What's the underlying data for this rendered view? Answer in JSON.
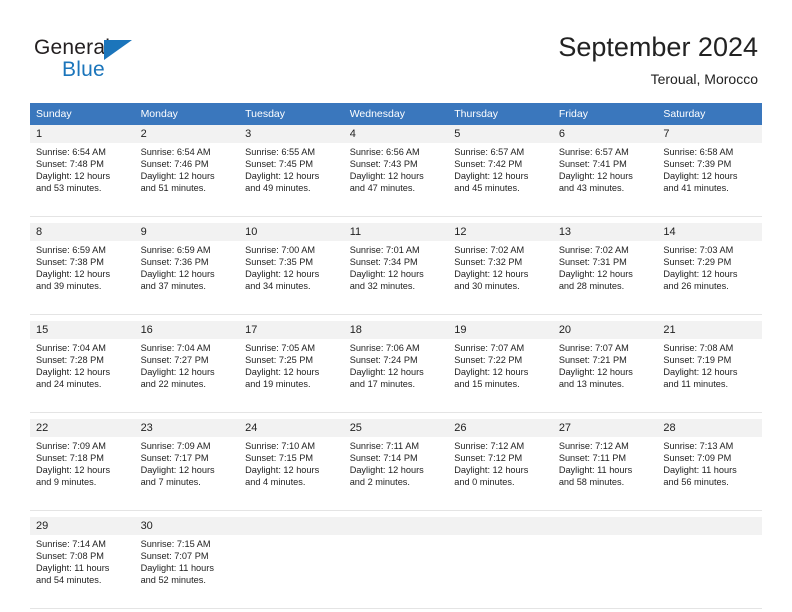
{
  "brand": {
    "name_part1": "General",
    "name_part2": "Blue",
    "triangle_color": "#1b75bb",
    "text_color": "#231f20"
  },
  "header": {
    "title": "September 2024",
    "subtitle": "Teroual, Morocco"
  },
  "theme": {
    "header_row_bg": "#3a77bd",
    "header_row_text": "#ffffff",
    "day_number_bg": "#f2f2f2",
    "cell_bg": "#ffffff",
    "text": "#222222",
    "grid_line": "#e4e4e4"
  },
  "weekdays": [
    "Sunday",
    "Monday",
    "Tuesday",
    "Wednesday",
    "Thursday",
    "Friday",
    "Saturday"
  ],
  "weeks": [
    [
      {
        "day": "1",
        "sunrise": "Sunrise: 6:54 AM",
        "sunset": "Sunset: 7:48 PM",
        "daylight1": "Daylight: 12 hours",
        "daylight2": "and 53 minutes."
      },
      {
        "day": "2",
        "sunrise": "Sunrise: 6:54 AM",
        "sunset": "Sunset: 7:46 PM",
        "daylight1": "Daylight: 12 hours",
        "daylight2": "and 51 minutes."
      },
      {
        "day": "3",
        "sunrise": "Sunrise: 6:55 AM",
        "sunset": "Sunset: 7:45 PM",
        "daylight1": "Daylight: 12 hours",
        "daylight2": "and 49 minutes."
      },
      {
        "day": "4",
        "sunrise": "Sunrise: 6:56 AM",
        "sunset": "Sunset: 7:43 PM",
        "daylight1": "Daylight: 12 hours",
        "daylight2": "and 47 minutes."
      },
      {
        "day": "5",
        "sunrise": "Sunrise: 6:57 AM",
        "sunset": "Sunset: 7:42 PM",
        "daylight1": "Daylight: 12 hours",
        "daylight2": "and 45 minutes."
      },
      {
        "day": "6",
        "sunrise": "Sunrise: 6:57 AM",
        "sunset": "Sunset: 7:41 PM",
        "daylight1": "Daylight: 12 hours",
        "daylight2": "and 43 minutes."
      },
      {
        "day": "7",
        "sunrise": "Sunrise: 6:58 AM",
        "sunset": "Sunset: 7:39 PM",
        "daylight1": "Daylight: 12 hours",
        "daylight2": "and 41 minutes."
      }
    ],
    [
      {
        "day": "8",
        "sunrise": "Sunrise: 6:59 AM",
        "sunset": "Sunset: 7:38 PM",
        "daylight1": "Daylight: 12 hours",
        "daylight2": "and 39 minutes."
      },
      {
        "day": "9",
        "sunrise": "Sunrise: 6:59 AM",
        "sunset": "Sunset: 7:36 PM",
        "daylight1": "Daylight: 12 hours",
        "daylight2": "and 37 minutes."
      },
      {
        "day": "10",
        "sunrise": "Sunrise: 7:00 AM",
        "sunset": "Sunset: 7:35 PM",
        "daylight1": "Daylight: 12 hours",
        "daylight2": "and 34 minutes."
      },
      {
        "day": "11",
        "sunrise": "Sunrise: 7:01 AM",
        "sunset": "Sunset: 7:34 PM",
        "daylight1": "Daylight: 12 hours",
        "daylight2": "and 32 minutes."
      },
      {
        "day": "12",
        "sunrise": "Sunrise: 7:02 AM",
        "sunset": "Sunset: 7:32 PM",
        "daylight1": "Daylight: 12 hours",
        "daylight2": "and 30 minutes."
      },
      {
        "day": "13",
        "sunrise": "Sunrise: 7:02 AM",
        "sunset": "Sunset: 7:31 PM",
        "daylight1": "Daylight: 12 hours",
        "daylight2": "and 28 minutes."
      },
      {
        "day": "14",
        "sunrise": "Sunrise: 7:03 AM",
        "sunset": "Sunset: 7:29 PM",
        "daylight1": "Daylight: 12 hours",
        "daylight2": "and 26 minutes."
      }
    ],
    [
      {
        "day": "15",
        "sunrise": "Sunrise: 7:04 AM",
        "sunset": "Sunset: 7:28 PM",
        "daylight1": "Daylight: 12 hours",
        "daylight2": "and 24 minutes."
      },
      {
        "day": "16",
        "sunrise": "Sunrise: 7:04 AM",
        "sunset": "Sunset: 7:27 PM",
        "daylight1": "Daylight: 12 hours",
        "daylight2": "and 22 minutes."
      },
      {
        "day": "17",
        "sunrise": "Sunrise: 7:05 AM",
        "sunset": "Sunset: 7:25 PM",
        "daylight1": "Daylight: 12 hours",
        "daylight2": "and 19 minutes."
      },
      {
        "day": "18",
        "sunrise": "Sunrise: 7:06 AM",
        "sunset": "Sunset: 7:24 PM",
        "daylight1": "Daylight: 12 hours",
        "daylight2": "and 17 minutes."
      },
      {
        "day": "19",
        "sunrise": "Sunrise: 7:07 AM",
        "sunset": "Sunset: 7:22 PM",
        "daylight1": "Daylight: 12 hours",
        "daylight2": "and 15 minutes."
      },
      {
        "day": "20",
        "sunrise": "Sunrise: 7:07 AM",
        "sunset": "Sunset: 7:21 PM",
        "daylight1": "Daylight: 12 hours",
        "daylight2": "and 13 minutes."
      },
      {
        "day": "21",
        "sunrise": "Sunrise: 7:08 AM",
        "sunset": "Sunset: 7:19 PM",
        "daylight1": "Daylight: 12 hours",
        "daylight2": "and 11 minutes."
      }
    ],
    [
      {
        "day": "22",
        "sunrise": "Sunrise: 7:09 AM",
        "sunset": "Sunset: 7:18 PM",
        "daylight1": "Daylight: 12 hours",
        "daylight2": "and 9 minutes."
      },
      {
        "day": "23",
        "sunrise": "Sunrise: 7:09 AM",
        "sunset": "Sunset: 7:17 PM",
        "daylight1": "Daylight: 12 hours",
        "daylight2": "and 7 minutes."
      },
      {
        "day": "24",
        "sunrise": "Sunrise: 7:10 AM",
        "sunset": "Sunset: 7:15 PM",
        "daylight1": "Daylight: 12 hours",
        "daylight2": "and 4 minutes."
      },
      {
        "day": "25",
        "sunrise": "Sunrise: 7:11 AM",
        "sunset": "Sunset: 7:14 PM",
        "daylight1": "Daylight: 12 hours",
        "daylight2": "and 2 minutes."
      },
      {
        "day": "26",
        "sunrise": "Sunrise: 7:12 AM",
        "sunset": "Sunset: 7:12 PM",
        "daylight1": "Daylight: 12 hours",
        "daylight2": "and 0 minutes."
      },
      {
        "day": "27",
        "sunrise": "Sunrise: 7:12 AM",
        "sunset": "Sunset: 7:11 PM",
        "daylight1": "Daylight: 11 hours",
        "daylight2": "and 58 minutes."
      },
      {
        "day": "28",
        "sunrise": "Sunrise: 7:13 AM",
        "sunset": "Sunset: 7:09 PM",
        "daylight1": "Daylight: 11 hours",
        "daylight2": "and 56 minutes."
      }
    ],
    [
      {
        "day": "29",
        "sunrise": "Sunrise: 7:14 AM",
        "sunset": "Sunset: 7:08 PM",
        "daylight1": "Daylight: 11 hours",
        "daylight2": "and 54 minutes."
      },
      {
        "day": "30",
        "sunrise": "Sunrise: 7:15 AM",
        "sunset": "Sunset: 7:07 PM",
        "daylight1": "Daylight: 11 hours",
        "daylight2": "and 52 minutes."
      },
      {
        "day": "",
        "sunrise": "",
        "sunset": "",
        "daylight1": "",
        "daylight2": ""
      },
      {
        "day": "",
        "sunrise": "",
        "sunset": "",
        "daylight1": "",
        "daylight2": ""
      },
      {
        "day": "",
        "sunrise": "",
        "sunset": "",
        "daylight1": "",
        "daylight2": ""
      },
      {
        "day": "",
        "sunrise": "",
        "sunset": "",
        "daylight1": "",
        "daylight2": ""
      },
      {
        "day": "",
        "sunrise": "",
        "sunset": "",
        "daylight1": "",
        "daylight2": ""
      }
    ]
  ]
}
